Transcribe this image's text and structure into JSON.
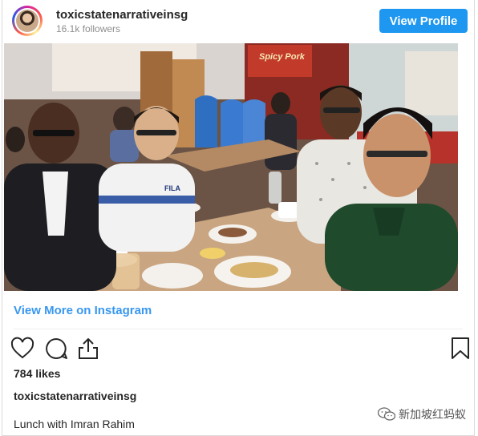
{
  "header": {
    "username": "toxicstatenarrativeinsg",
    "followers": "16.1k followers",
    "view_profile_label": "View Profile"
  },
  "photo": {
    "sign_text": "Spicy Pork"
  },
  "links": {
    "view_more": "View More on Instagram"
  },
  "actions": {
    "icons": [
      "heart-icon",
      "comment-icon",
      "share-icon",
      "bookmark-icon"
    ]
  },
  "post": {
    "likes": "784 likes",
    "caption_username": "toxicstatenarrativeinsg",
    "caption": "Lunch with Imran Rahim"
  },
  "watermark": {
    "text": "新加坡红蚂蚁"
  },
  "colors": {
    "accent": "#1d97f0",
    "link": "#3897f0",
    "text": "#262626",
    "muted": "#8e8e8e"
  }
}
